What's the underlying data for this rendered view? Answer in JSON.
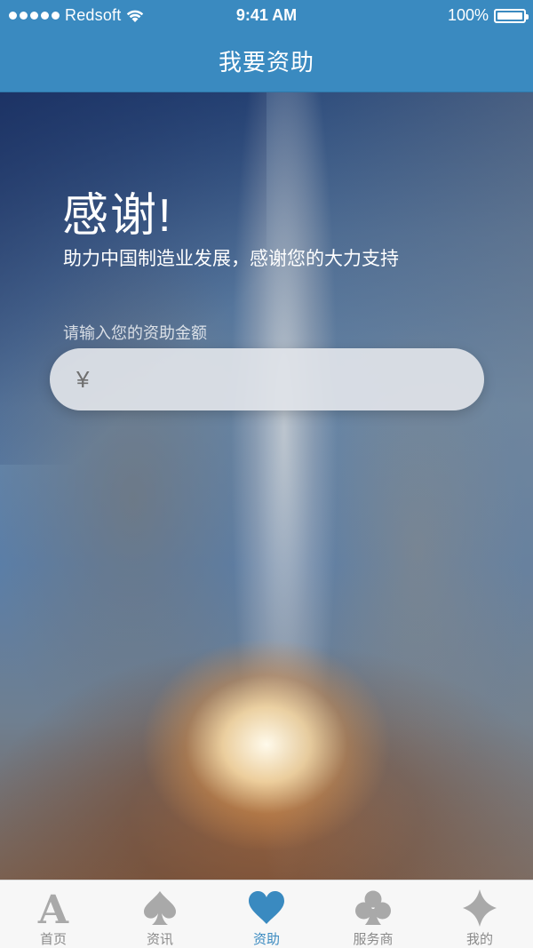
{
  "status_bar": {
    "carrier": "Redsoft",
    "time": "9:41 AM",
    "battery": "100%"
  },
  "nav": {
    "title": "我要资助"
  },
  "hero": {
    "heading": "感谢!",
    "subtitle": "助力中国制造业发展，感谢您的大力支持",
    "amount_label": "请输入您的资助金额",
    "currency_symbol": "¥",
    "amount_value": ""
  },
  "tabbar": {
    "items": [
      {
        "label": "首页",
        "icon": "letter-a-icon",
        "active": false
      },
      {
        "label": "资讯",
        "icon": "spade-icon",
        "active": false
      },
      {
        "label": "资助",
        "icon": "heart-icon",
        "active": true
      },
      {
        "label": "服务商",
        "icon": "club-icon",
        "active": false
      },
      {
        "label": "我的",
        "icon": "diamond-icon",
        "active": false
      }
    ]
  },
  "colors": {
    "primary": "#3a8ac0",
    "tab_inactive": "#8a8a8a",
    "tab_icon_inactive": "#a9a9a9"
  }
}
